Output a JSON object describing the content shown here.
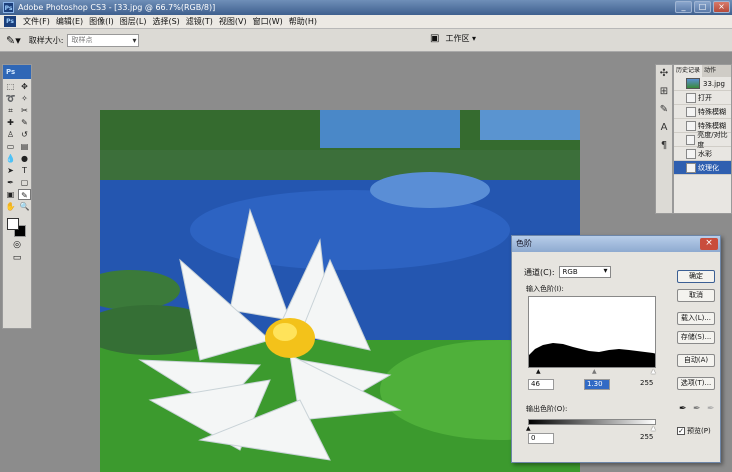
{
  "window": {
    "title": "Adobe Photoshop CS3 - [33.jpg @ 66.7%(RGB/8)]"
  },
  "app_badge": "Ps",
  "menu": [
    "文件(F)",
    "编辑(E)",
    "图像(I)",
    "图层(L)",
    "选择(S)",
    "滤镜(T)",
    "视图(V)",
    "窗口(W)",
    "帮助(H)"
  ],
  "options": {
    "sample_label": "取样大小:",
    "sample_value": "取样点",
    "workspace_label": "工作区 ▾"
  },
  "history_panel": {
    "tabs": [
      "历史记录",
      "动作"
    ],
    "snapshot": "33.jpg",
    "items": [
      "打开",
      "特殊模糊",
      "特殊模糊",
      "亮度/对比度",
      "水彩",
      "纹理化"
    ],
    "selected_index": 5
  },
  "levels_dialog": {
    "title": "色阶",
    "channel_label": "通道(C):",
    "channel_value": "RGB",
    "input_label": "输入色阶(I):",
    "input_values": [
      "46",
      "1.30",
      "255"
    ],
    "output_label": "输出色阶(O):",
    "output_values": [
      "0",
      "255"
    ],
    "buttons": [
      "确定",
      "取消",
      "载入(L)...",
      "存储(S)...",
      "自动(A)",
      "选项(T)..."
    ],
    "preview_label": "预览(P)",
    "preview_checked": true
  },
  "colors": {
    "foreground": "#ffffff",
    "background": "#000000",
    "accent": "#2f5fb0"
  }
}
